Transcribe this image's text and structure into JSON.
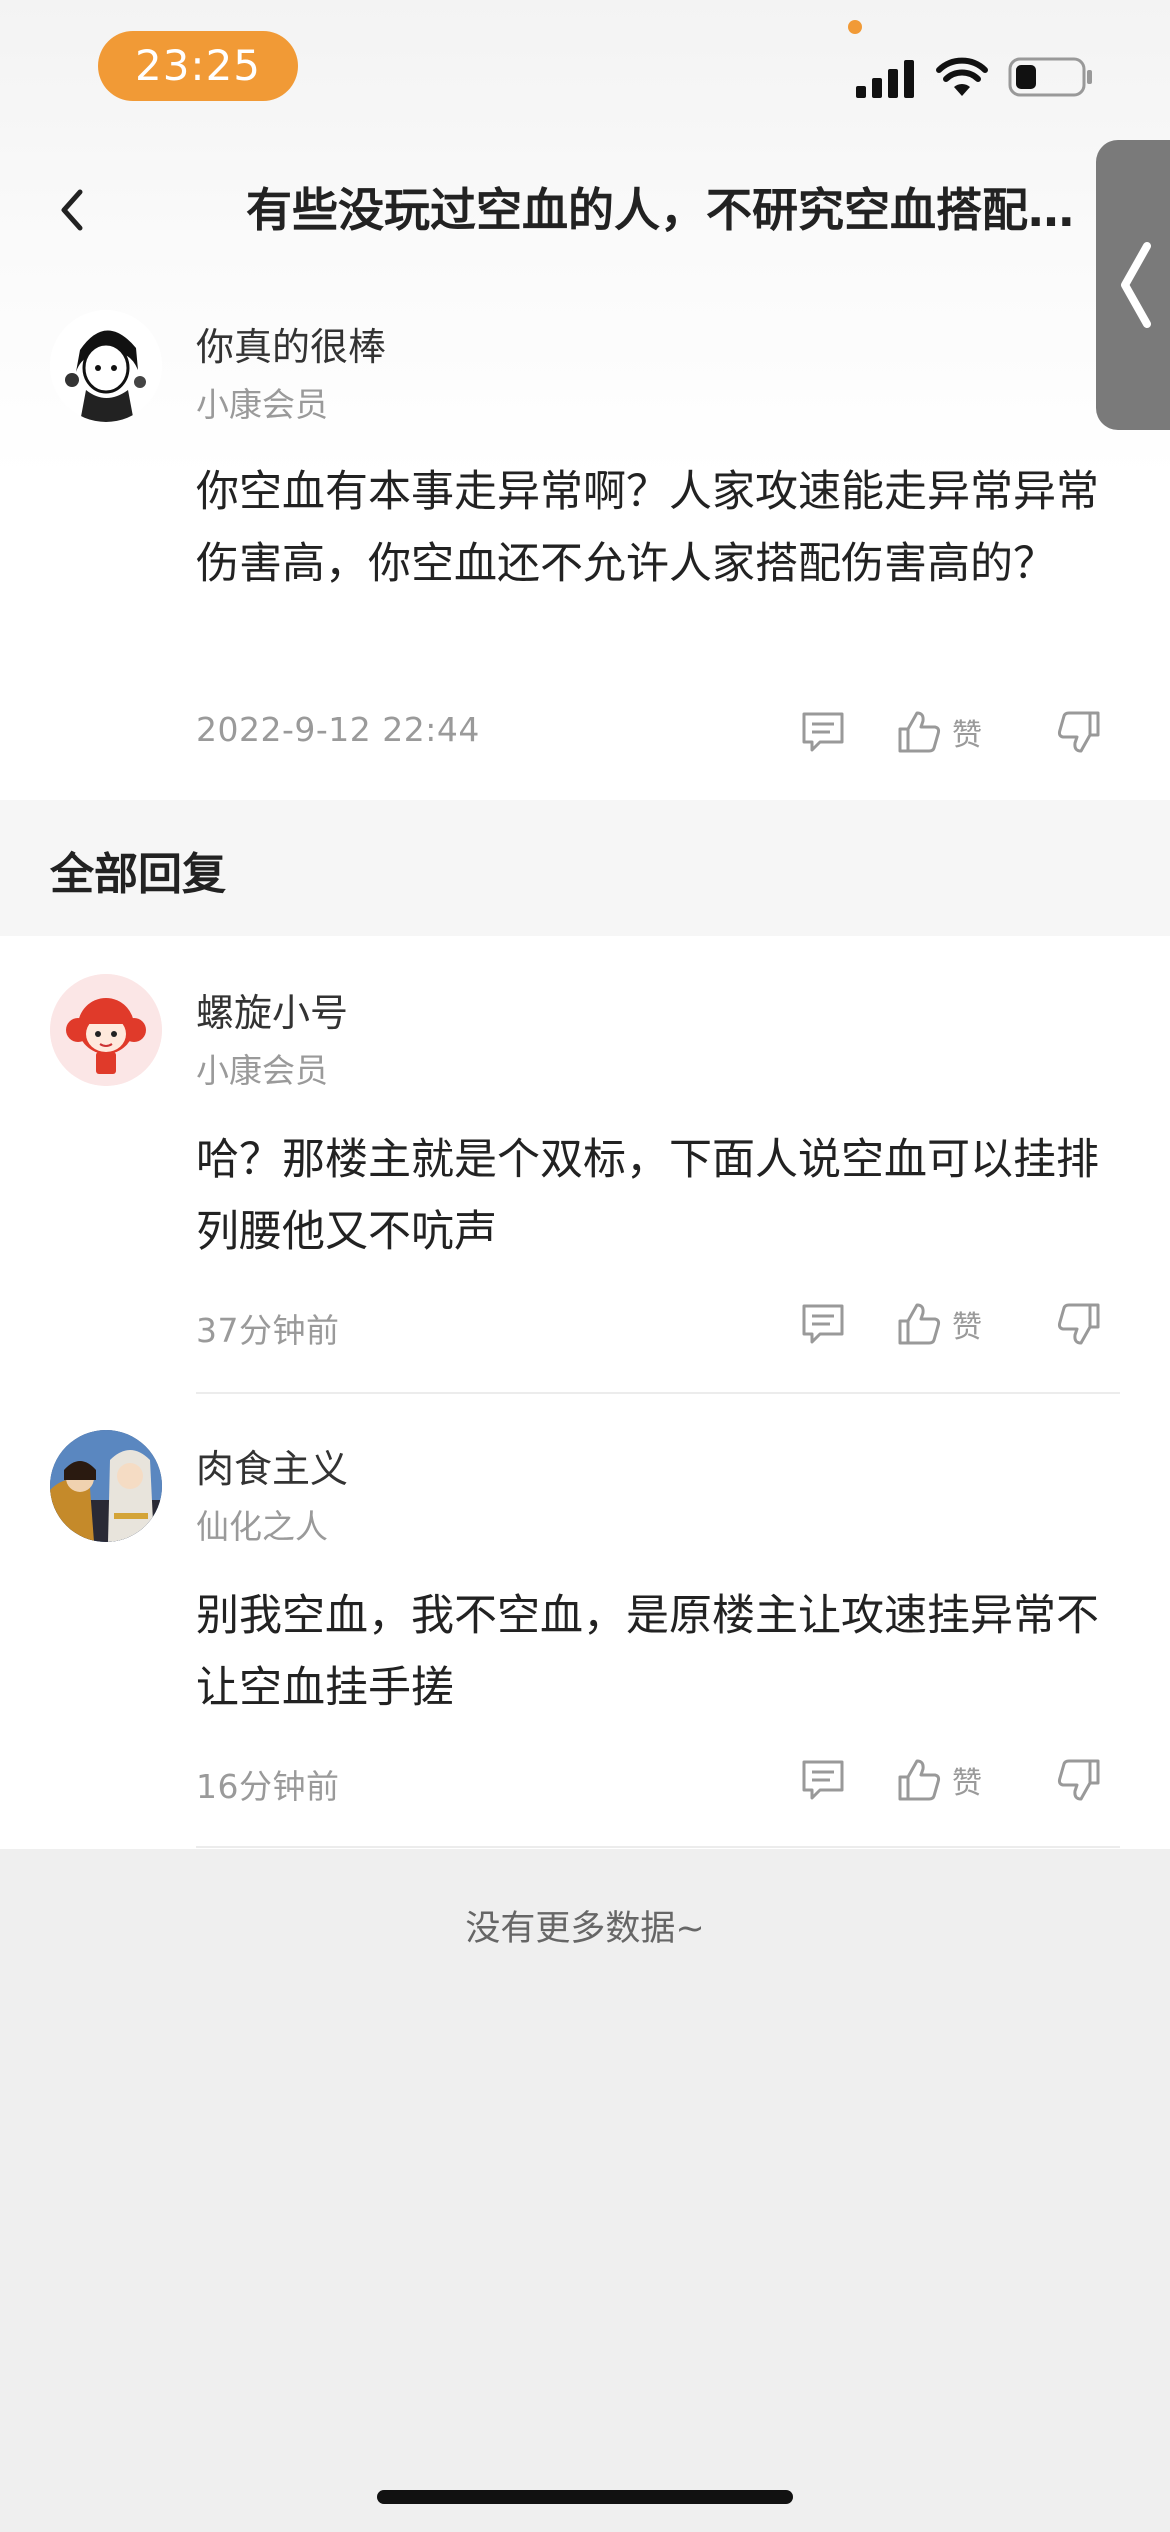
{
  "status_bar": {
    "time": "23:25"
  },
  "nav": {
    "title": "有些没玩过空血的人，不研究空血搭配…"
  },
  "post": {
    "author": "你真的很棒",
    "rank": "小康会员",
    "content": "你空血有本事走异常啊？人家攻速能走异常异常伤害高，你空血还不允许人家搭配伤害高的？",
    "time": "2022-9-12 22:44",
    "like_label": "赞"
  },
  "section": {
    "title": "全部回复"
  },
  "replies": [
    {
      "author": "螺旋小号",
      "rank": "小康会员",
      "content": "哈？那楼主就是个双标，下面人说空血可以挂排列腰他又不吭声",
      "time": "37分钟前",
      "like_label": "赞"
    },
    {
      "author": "肉食主义",
      "rank": "仙化之人",
      "content": "别我空血，我不空血，是原楼主让攻速挂异常不让空血挂手搓",
      "time": "16分钟前",
      "like_label": "赞"
    }
  ],
  "footer": {
    "no_more": "没有更多数据~"
  },
  "colors": {
    "accent": "#f19a36",
    "side_tab": "#7a7a7a",
    "page_bg": "#efefef"
  },
  "icons": [
    "signal-icon",
    "wifi-icon",
    "battery-icon",
    "back-icon",
    "side-collapse-icon",
    "comment-icon",
    "thumbs-up-icon",
    "thumbs-down-icon"
  ]
}
